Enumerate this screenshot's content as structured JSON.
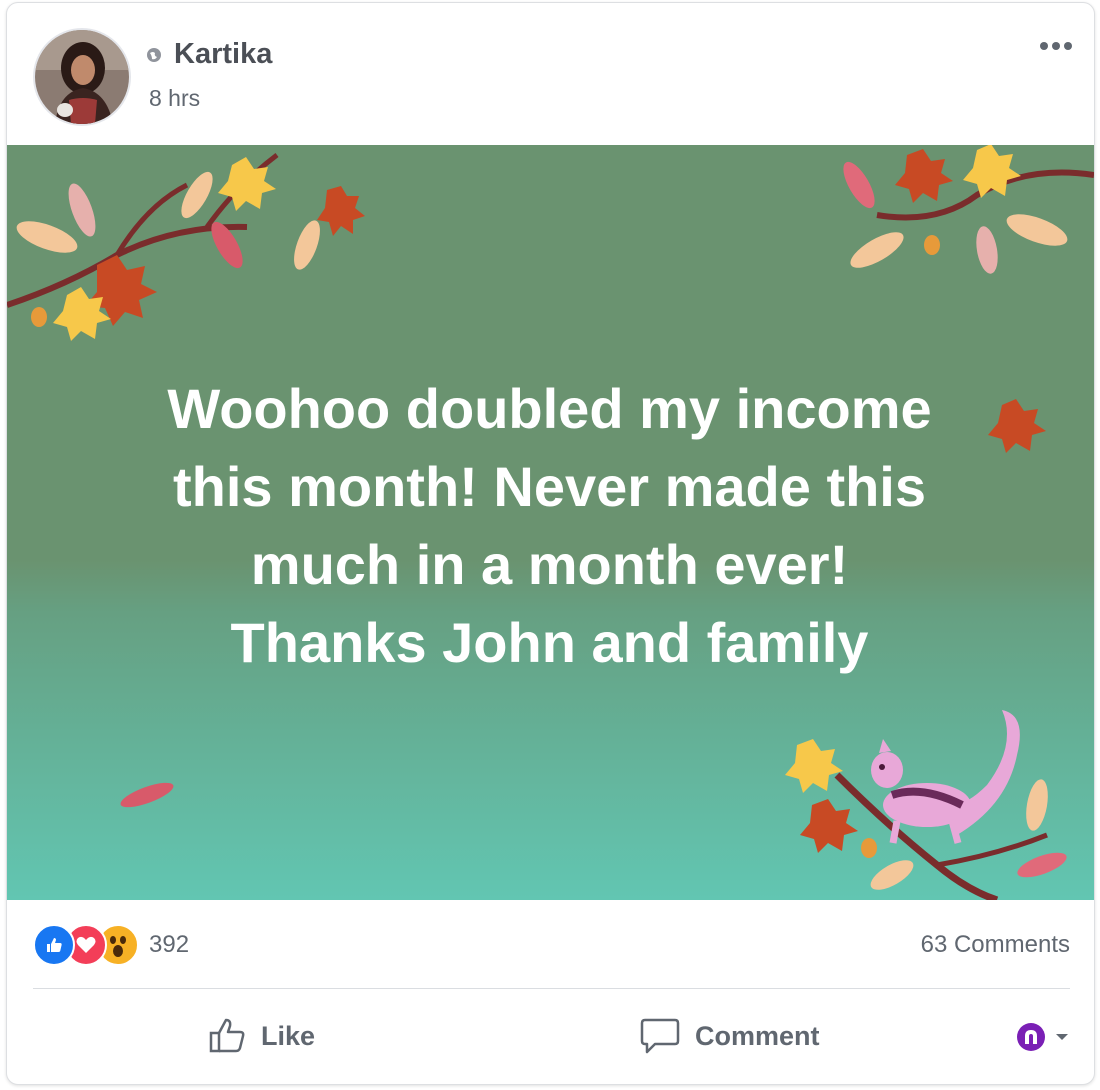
{
  "post": {
    "author": "Kartika",
    "timestamp": "8 hrs",
    "privacy_icon": "globe-icon",
    "more_icon": "more-options-icon"
  },
  "banner": {
    "lines": [
      "Woohoo doubled my income",
      "this month! Never made this",
      "much in a month ever!",
      "Thanks John and family"
    ],
    "top_color": "#6a9370",
    "bottom_color": "#62c6b2"
  },
  "stats": {
    "reactions": [
      "like",
      "love",
      "wow"
    ],
    "reaction_count": "392",
    "comments": "63 Comments"
  },
  "actions": {
    "like_label": "Like",
    "comment_label": "Comment"
  },
  "colors": {
    "like_blue": "#1877f2",
    "love_red": "#f33e58",
    "wow_yellow": "#f7b125",
    "text_gray": "#606770"
  }
}
